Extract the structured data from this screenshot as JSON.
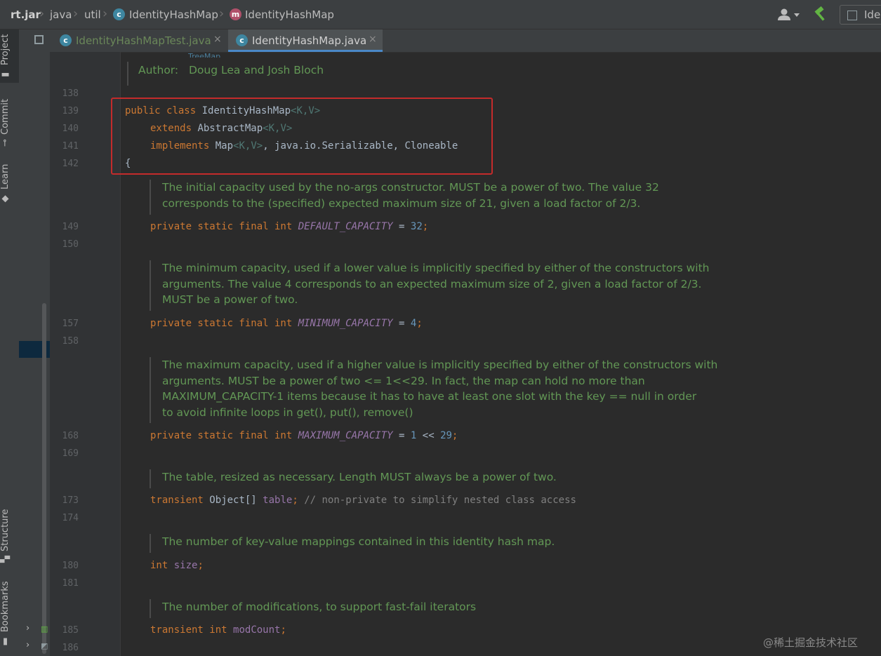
{
  "navbar": {
    "breadcrumb": [
      "rt.jar",
      "java",
      "util",
      "IdentityHashMap",
      "IdentityHashMap"
    ],
    "run_config_label": "Ide"
  },
  "tool_windows": {
    "left": [
      "Project",
      "Commit",
      "Learn",
      "Structure",
      "Bookmarks"
    ]
  },
  "tabs": [
    {
      "label": "IdentityHashMapTest.java",
      "active": false
    },
    {
      "label": "IdentityHashMap.java",
      "active": true
    }
  ],
  "editor": {
    "doc_author_key": "Author:",
    "doc_author_value": "Doug Lea and Josh Bloch",
    "doc_link_fragment": "TreeMap",
    "line_numbers": {
      "l138": "138",
      "l139": "139",
      "l140": "140",
      "l141": "141",
      "l142": "142",
      "l149": "149",
      "l150": "150",
      "l157": "157",
      "l158": "158",
      "l168": "168",
      "l169": "169",
      "l173": "173",
      "l174": "174",
      "l180": "180",
      "l181": "181",
      "l185": "185",
      "l186": "186"
    },
    "docs": {
      "default_capacity": [
        "The initial capacity used by the no-args constructor. MUST be a power of two. The value 32",
        "corresponds to the (specified) expected maximum size of 21, given a load factor of 2/3."
      ],
      "minimum_capacity": [
        "The minimum capacity, used if a lower value is implicitly specified by either of the constructors with",
        "arguments. The value 4 corresponds to an expected maximum size of 2, given a load factor of 2/3.",
        "MUST be a power of two."
      ],
      "maximum_capacity": [
        "The maximum capacity, used if a higher value is implicitly specified by either of the constructors with",
        "arguments. MUST be a power of two <= 1<<29. In fact, the map can hold no more than",
        "MAXIMUM_CAPACITY-1 items because it has to have at least one slot with the key == null in order",
        "to avoid infinite loops in get(), put(), remove()"
      ],
      "table": [
        "The table, resized as necessary. Length MUST always be a power of two."
      ],
      "size": [
        "The number of key-value mappings contained in this identity hash map."
      ],
      "mod_count": [
        "The number of modifications, to support fast-fail iterators"
      ]
    },
    "code": {
      "kw_public": "public",
      "kw_class": "class",
      "class_name": "IdentityHashMap",
      "type_params": "<K,V>",
      "kw_extends": "extends",
      "super_class": "AbstractMap",
      "kw_implements": "implements",
      "iface_map": "Map",
      "ifaces_rest": ", java.io.Serializable, Cloneable",
      "brace_open": "{",
      "kw_psfi": "private static final int",
      "default_capacity_name": "DEFAULT_CAPACITY",
      "default_capacity_value": "32",
      "minimum_capacity_name": "MINIMUM_CAPACITY",
      "minimum_capacity_value": "4",
      "maximum_capacity_name": "MAXIMUM_CAPACITY",
      "maximum_capacity_value": "1",
      "shift_op": "<<",
      "shift_value": "29",
      "kw_transient": "transient",
      "object_array": "Object[]",
      "table_name": "table",
      "table_comment": "// non-private to simplify nested class access",
      "kw_int": "int",
      "size_name": "size",
      "mod_count_name": "modCount",
      "eq": " = ",
      "semi": ";"
    }
  },
  "watermark": "@稀土掘金技术社区",
  "colors": {
    "highlight_box": "#c42b2b",
    "keyword": "#cc7832",
    "doc_comment": "#629755",
    "constant": "#9876aa",
    "number": "#6897bb"
  }
}
